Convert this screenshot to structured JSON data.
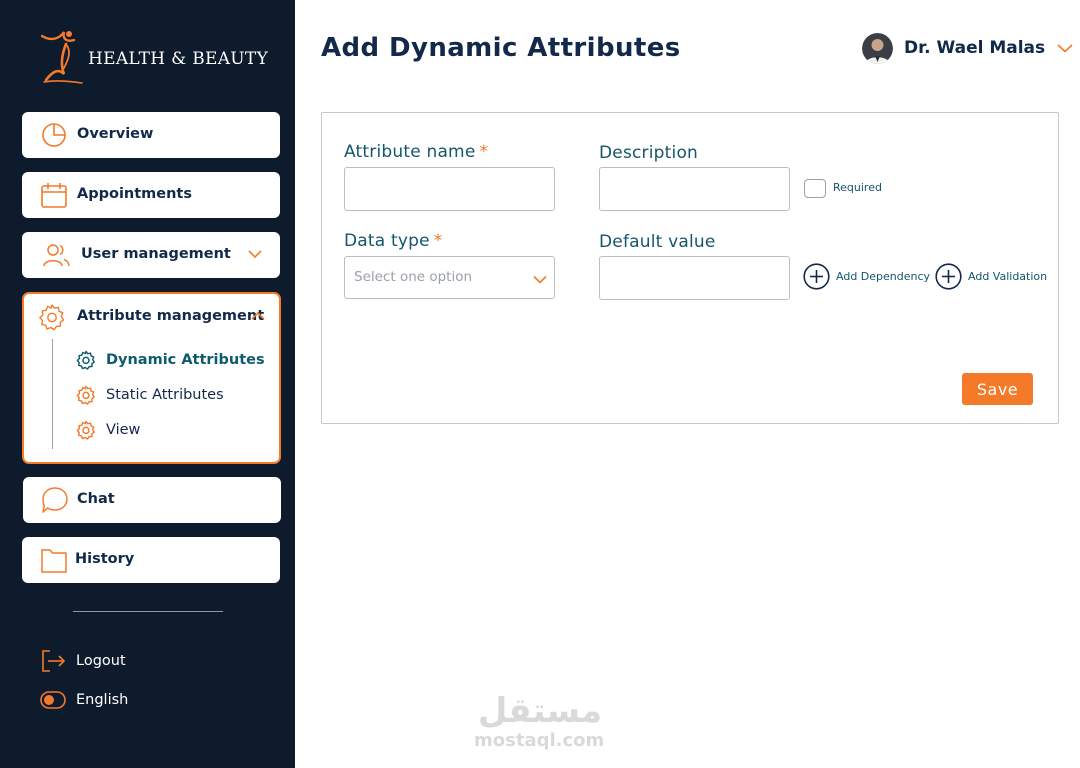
{
  "brand": {
    "name": "HEALTH & BEAUTY",
    "logo_icon": "figure-swirl-icon",
    "accent_color": "#f47a2a",
    "sidebar_bg": "#0d1b2d"
  },
  "sidebar": {
    "items": [
      {
        "label": "Overview",
        "icon": "pie-chart-icon"
      },
      {
        "label": "Appointments",
        "icon": "calendar-icon"
      },
      {
        "label": "User management",
        "icon": "users-icon"
      },
      {
        "label": "Attribute management",
        "icon": "gear-icon",
        "expanded": true,
        "children": [
          {
            "label": "Dynamic Attributes",
            "icon": "gear-icon",
            "active": true
          },
          {
            "label": "Static Attributes",
            "icon": "gear-icon"
          },
          {
            "label": "View",
            "icon": "gear-icon"
          }
        ]
      },
      {
        "label": "Chat",
        "icon": "chat-bubble-icon"
      },
      {
        "label": "History",
        "icon": "folder-icon"
      }
    ],
    "footer": [
      {
        "label": "Logout",
        "icon": "logout-icon"
      },
      {
        "label": "English",
        "icon": "toggle-icon"
      }
    ]
  },
  "header": {
    "title": "Add Dynamic Attributes",
    "user_name": "Dr. Wael Malas"
  },
  "form": {
    "attribute_name": {
      "label": "Attribute name",
      "required_mark": "*",
      "value": ""
    },
    "description": {
      "label": "Description",
      "value": ""
    },
    "required_checkbox": {
      "label": "Required",
      "checked": false
    },
    "data_type": {
      "label": "Data type",
      "required_mark": "*",
      "placeholder": "Select one option"
    },
    "default_value": {
      "label": "Default value",
      "value": ""
    },
    "add_dependency": "Add Dependency",
    "add_validation": "Add Validation",
    "save": "Save"
  },
  "watermark": {
    "arabic": "مستقل",
    "latin": "mostaql.com"
  }
}
